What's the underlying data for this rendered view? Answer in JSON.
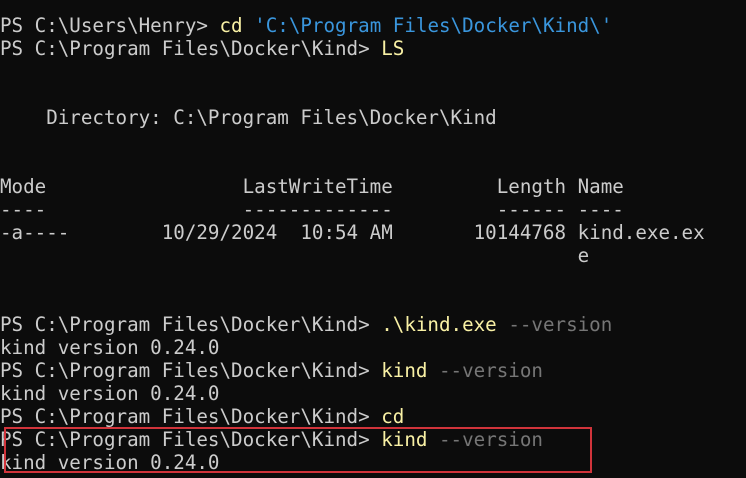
{
  "terminal": {
    "line1": {
      "prompt": "PS C:\\Users\\Henry> ",
      "cmd": "cd",
      "space": " ",
      "arg": "'C:\\Program Files\\Docker\\Kind\\'"
    },
    "line2": {
      "prompt": "PS C:\\Program Files\\Docker\\Kind> ",
      "cmd": "LS"
    },
    "directory": "    Directory: C:\\Program Files\\Docker\\Kind",
    "header": "Mode                 LastWriteTime         Length Name",
    "underline": "----                 -------------         ------ ----",
    "row1": "-a----        10/29/2024  10:54 AM       10144768 kind.exe.ex",
    "row1_wrap": "                                                  e",
    "cmd3": {
      "prompt": "PS C:\\Program Files\\Docker\\Kind> ",
      "cmd": ".\\kind.exe",
      "space": " ",
      "flag": "--version"
    },
    "out3": "kind version 0.24.0",
    "cmd4": {
      "prompt": "PS C:\\Program Files\\Docker\\Kind> ",
      "cmd": "kind",
      "space": " ",
      "flag": "--version"
    },
    "out4": "kind version 0.24.0",
    "cmd5": {
      "prompt": "PS C:\\Program Files\\Docker\\Kind> ",
      "cmd": "cd"
    },
    "cmd6": {
      "prompt": "PS C:\\Program Files\\Docker\\Kind> ",
      "cmd": "kind",
      "space": " ",
      "flag": "--version"
    },
    "out6": "kind version 0.24.0"
  },
  "colors": {
    "background": "#0c0c0c",
    "text": "#cccccc",
    "command": "#f9f1a5",
    "string": "#3a96dd",
    "parameter": "#767676",
    "highlight": "#d1343b"
  }
}
